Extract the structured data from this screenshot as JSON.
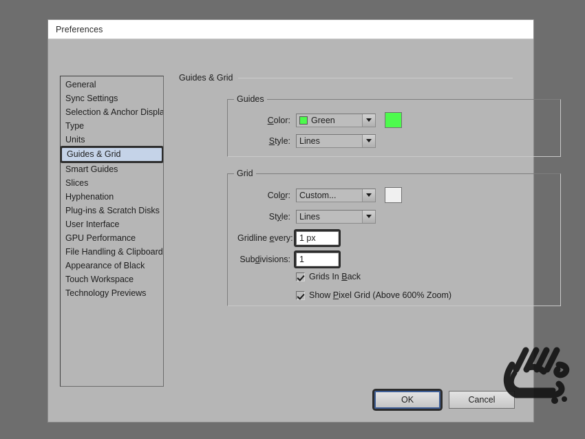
{
  "window": {
    "title": "Preferences"
  },
  "sidebar": {
    "items": [
      {
        "label": "General",
        "selected": false
      },
      {
        "label": "Sync Settings",
        "selected": false
      },
      {
        "label": "Selection & Anchor Display",
        "selected": false
      },
      {
        "label": "Type",
        "selected": false
      },
      {
        "label": "Units",
        "selected": false
      },
      {
        "label": "Guides & Grid",
        "selected": true
      },
      {
        "label": "Smart Guides",
        "selected": false
      },
      {
        "label": "Slices",
        "selected": false
      },
      {
        "label": "Hyphenation",
        "selected": false
      },
      {
        "label": "Plug-ins & Scratch Disks",
        "selected": false
      },
      {
        "label": "User Interface",
        "selected": false
      },
      {
        "label": "GPU Performance",
        "selected": false
      },
      {
        "label": "File Handling & Clipboard",
        "selected": false
      },
      {
        "label": "Appearance of Black",
        "selected": false
      },
      {
        "label": "Touch Workspace",
        "selected": false
      },
      {
        "label": "Technology Previews",
        "selected": false
      }
    ]
  },
  "pane": {
    "heading": "Guides & Grid",
    "guides": {
      "legend": "Guides",
      "color": {
        "label_pre": "",
        "label_mn": "C",
        "label_post": "olor:",
        "value": "Green",
        "swatch_hex": "#4dfa4d",
        "box_hex": "#4dfa4d"
      },
      "style": {
        "label_pre": "",
        "label_mn": "S",
        "label_post": "tyle:",
        "value": "Lines"
      }
    },
    "grid": {
      "legend": "Grid",
      "color": {
        "label_pre": "Col",
        "label_mn": "o",
        "label_post": "r:",
        "value": "Custom...",
        "box_hex": "#f0f0f0"
      },
      "style": {
        "label_pre": "St",
        "label_mn": "y",
        "label_post": "le:",
        "value": "Lines"
      },
      "gridline_every": {
        "label_pre": "Gridline ",
        "label_mn": "e",
        "label_post": "very:",
        "value": "1 px"
      },
      "subdivisions": {
        "label_pre": "Sub",
        "label_mn": "d",
        "label_post": "ivisions:",
        "value": "1"
      },
      "grids_in_back": {
        "label_pre": "Grids In ",
        "label_mn": "B",
        "label_post": "ack",
        "checked": true
      },
      "show_pixel_grid": {
        "label_pre": "Show ",
        "label_mn": "P",
        "label_post": "ixel Grid (Above 600% Zoom)",
        "checked": true
      }
    }
  },
  "footer": {
    "ok_label": "OK",
    "cancel_label": "Cancel"
  },
  "colors": {
    "dialog_bg": "#b6b6b6",
    "desktop_bg": "#6e6e6e",
    "selection_bg": "#c5d3e8",
    "highlight_border": "#2c2c2c",
    "focus_ring": "#3f5f96"
  }
}
